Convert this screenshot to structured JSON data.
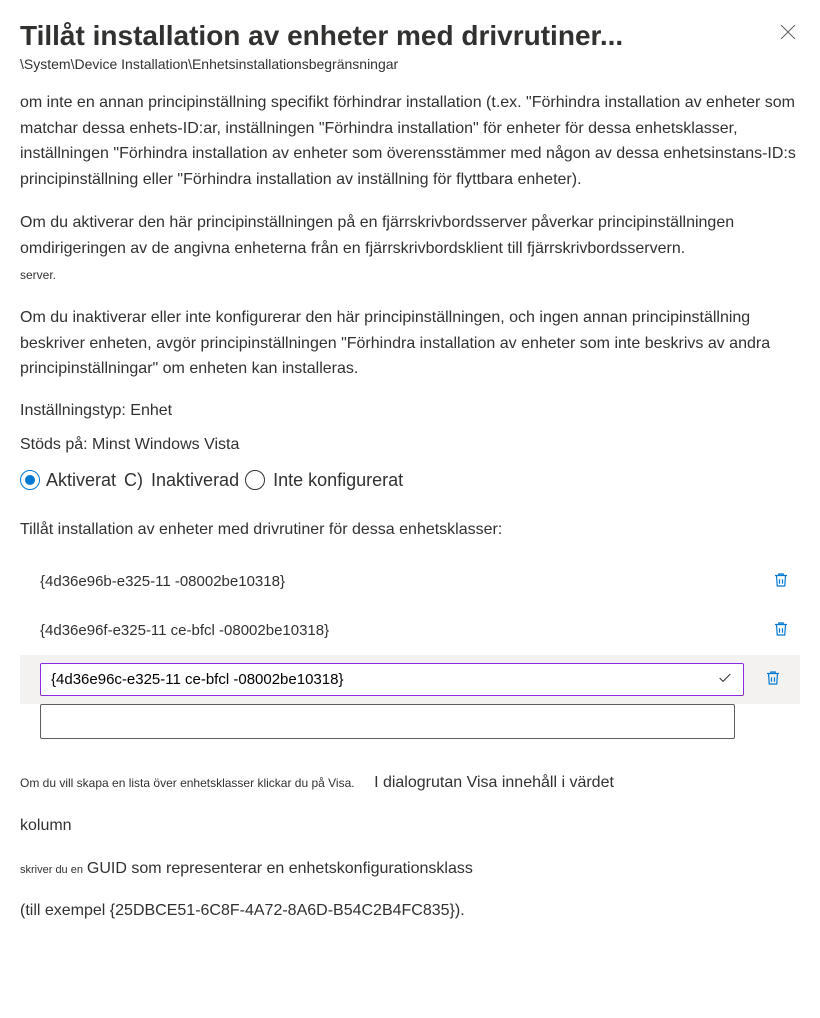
{
  "header": {
    "title": "Tillåt installation av enheter med drivrutiner...",
    "breadcrumb": "\\System\\Device Installation\\Enhetsinstallationsbegränsningar"
  },
  "description": {
    "p1": "om inte en annan principinställning specifikt förhindrar installation (t.ex. \"Förhindra installation av enheter som matchar dessa enhets-ID:ar, inställningen \"Förhindra installation\" för enheter för dessa enhetsklasser, inställningen \"Förhindra installation av enheter som överensstämmer med någon av dessa enhetsinstans-ID:s principinställning eller \"Förhindra installation av inställning för flyttbara enheter).",
    "p2": "Om du aktiverar den här principinställningen på en fjärrskrivbordsserver påverkar principinställningen omdirigeringen av de angivna enheterna från en fjärrskrivbordsklient till fjärrskrivbordsservern.",
    "p2_small": "server.",
    "p3": "Om du inaktiverar eller inte konfigurerar den här principinställningen, och ingen annan principinställning beskriver enheten, avgör principinställningen \"Förhindra installation av enheter som inte beskrivs av andra principinställningar\" om enheten kan installeras."
  },
  "meta": {
    "setting_type": "Inställningstyp: Enhet",
    "supported_on": "Stöds på: Minst Windows Vista"
  },
  "radio": {
    "enabled": "Aktiverat",
    "disabled_prefix": "C)",
    "disabled": "Inaktiverad",
    "not_configured": "Inte konfigurerat"
  },
  "list": {
    "label": "Tillåt installation av enheter med drivrutiner för dessa enhetsklasser:",
    "items": [
      "{4d36e96b-e325-11 -08002be10318}",
      "{4d36e96f-e325-11 ce-bfcl -08002be10318}"
    ],
    "editing_value": "{4d36e96c-e325-11 ce-bfcl -08002be10318}"
  },
  "footer": {
    "t1": "Om du vill skapa en lista över enhetsklasser klickar du på Visa.",
    "t2": "I dialogrutan Visa innehåll i värdet",
    "t3": "kolumn",
    "t4_small": "skriver du en",
    "t4": "GUID som representerar en enhetskonfigurationsklass",
    "t5": "(till exempel {25DBCE51-6C8F-4A72-8A6D-B54C2B4FC835})."
  }
}
